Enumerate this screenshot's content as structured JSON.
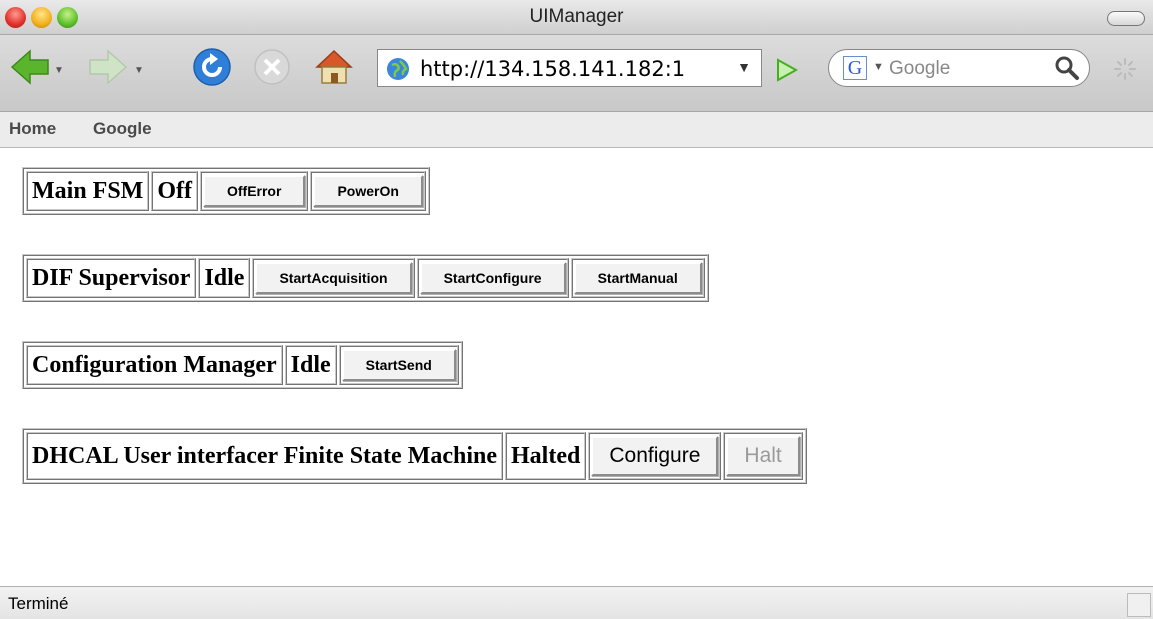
{
  "window": {
    "title": "UIManager"
  },
  "toolbar": {
    "url": "http://134.158.141.182:1",
    "search_engine": "Google",
    "search_placeholder": "Google"
  },
  "bookmarks": [
    {
      "label": "Home"
    },
    {
      "label": "Google"
    }
  ],
  "fsm_panels": [
    {
      "name": "Main FSM",
      "state": "Off",
      "buttons": [
        "OffError",
        "PowerOn"
      ]
    },
    {
      "name": "DIF Supervisor",
      "state": "Idle",
      "buttons": [
        "StartAcquisition",
        "StartConfigure",
        "StartManual"
      ]
    },
    {
      "name": "Configuration Manager",
      "state": "Idle",
      "buttons": [
        "StartSend"
      ]
    },
    {
      "name": "DHCAL User interfacer Finite State Machine",
      "state": "Halted",
      "buttons": [
        "Configure",
        "Halt"
      ]
    }
  ],
  "status": {
    "text": "Terminé"
  },
  "colors": {
    "back_arrow": "#5bb52c",
    "reload": "#2f7fd8",
    "stop": "#d9d9d9",
    "go": "#44b020"
  },
  "icons": [
    "back-arrow-icon",
    "forward-arrow-icon",
    "reload-icon",
    "stop-icon",
    "home-icon",
    "globe-icon",
    "go-icon",
    "search-icon",
    "spinner-icon"
  ]
}
